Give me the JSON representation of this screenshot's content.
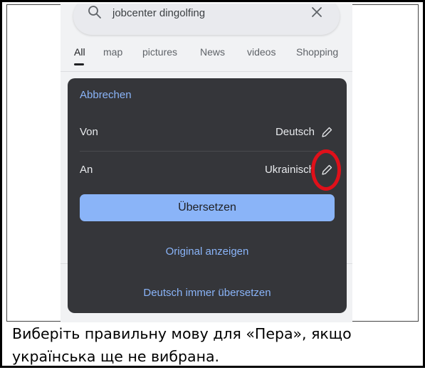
{
  "search": {
    "query": "jobcenter dingolfing",
    "search_icon": "search-icon",
    "clear_icon": "close-icon"
  },
  "tabs": [
    {
      "label": "All",
      "active": true
    },
    {
      "label": "map"
    },
    {
      "label": "pictures"
    },
    {
      "label": "News"
    },
    {
      "label": "videos"
    },
    {
      "label": "Shopping"
    }
  ],
  "translate_sheet": {
    "cancel_label": "Abbrechen",
    "from_label": "Von",
    "from_value": "Deutsch",
    "to_label": "An",
    "to_value": "Ukrainisch",
    "edit_icon": "pencil-icon",
    "translate_button": "Übersetzen",
    "show_original": "Original anzeigen",
    "always_translate": "Deutsch immer übersetzen"
  },
  "caption": "Виберіть правильну мову для «Пера», якщо українська ще не вибрана.",
  "colors": {
    "sheet_bg": "#35363a",
    "accent": "#8ab4f8",
    "highlight": "#e0101a"
  }
}
